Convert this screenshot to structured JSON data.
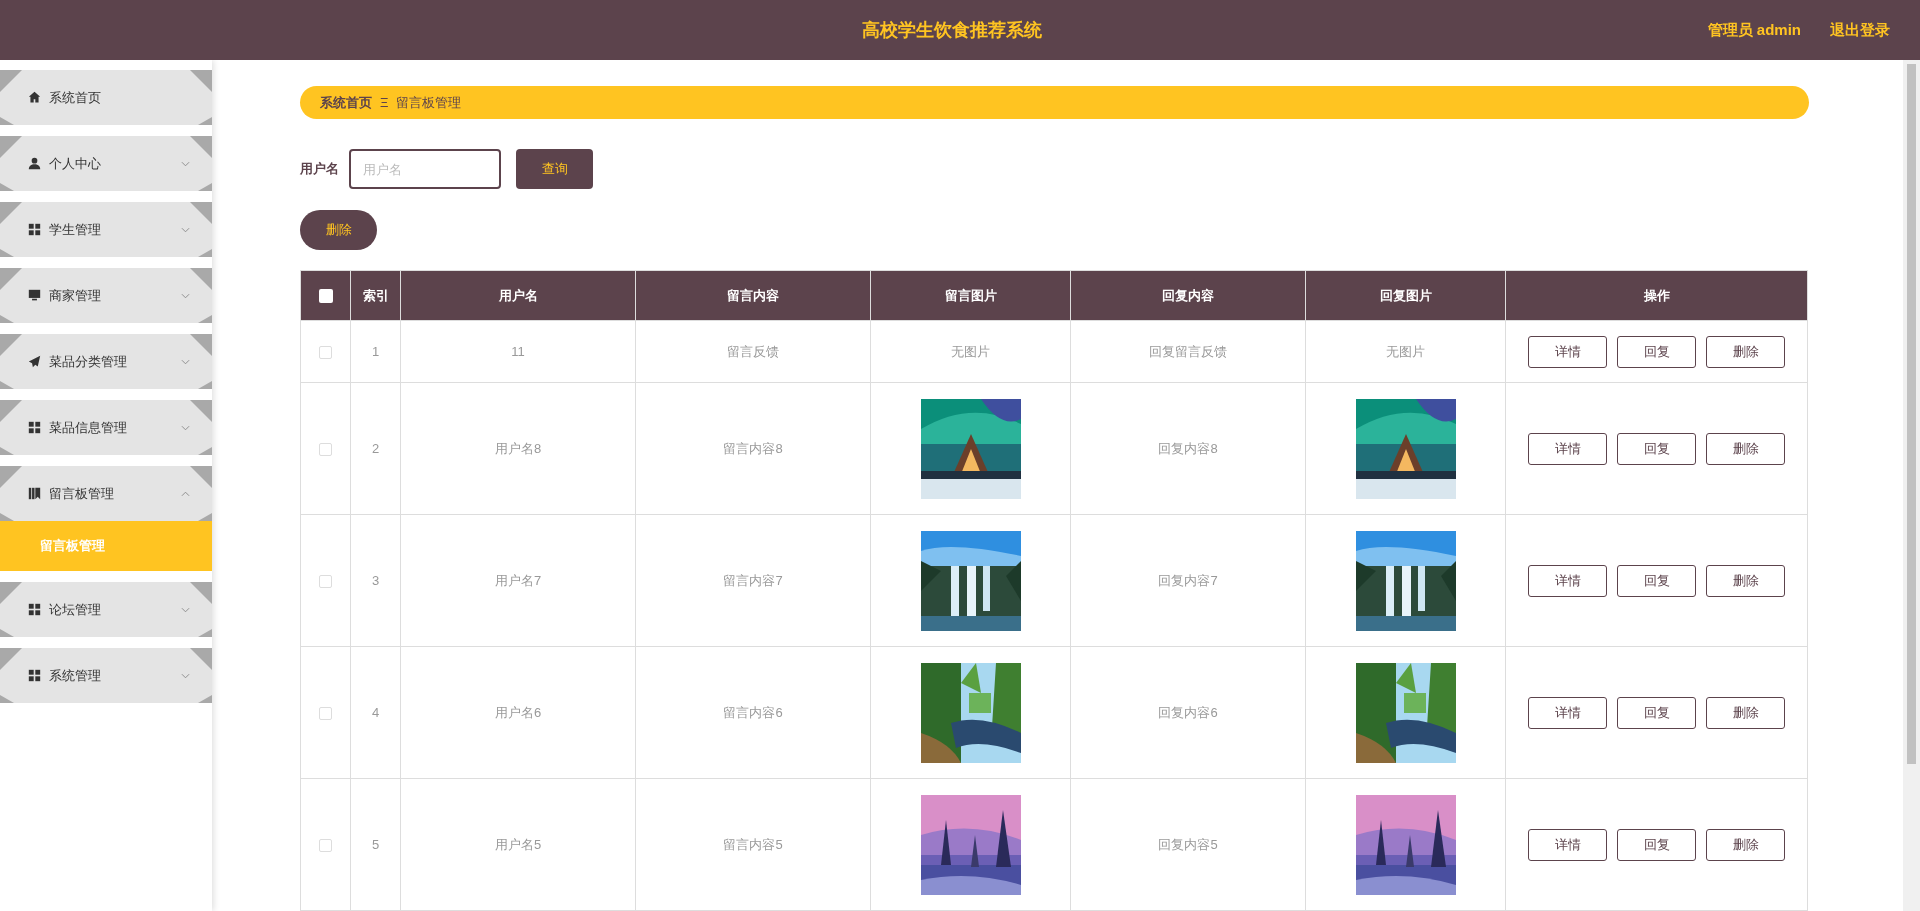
{
  "header": {
    "title": "高校学生饮食推荐系统",
    "user": "管理员 admin",
    "logout": "退出登录"
  },
  "sidebar": {
    "items": [
      {
        "kind": "link",
        "label": "系统首页"
      },
      {
        "kind": "menu",
        "label": "个人中心",
        "expanded": false
      },
      {
        "kind": "menu",
        "label": "学生管理",
        "expanded": false
      },
      {
        "kind": "menu",
        "label": "商家管理",
        "expanded": false
      },
      {
        "kind": "menu",
        "label": "菜品分类管理",
        "expanded": false
      },
      {
        "kind": "menu",
        "label": "菜品信息管理",
        "expanded": false
      },
      {
        "kind": "menu",
        "label": "留言板管理",
        "expanded": true,
        "children": [
          {
            "label": "留言板管理",
            "selected": true
          }
        ]
      },
      {
        "kind": "menu",
        "label": "论坛管理",
        "expanded": false
      },
      {
        "kind": "menu",
        "label": "系统管理",
        "expanded": false
      }
    ]
  },
  "breadcrumb": {
    "items": [
      "系统首页",
      "留言板管理"
    ],
    "separator": "Ξ"
  },
  "search": {
    "label": "用户名",
    "placeholder": "用户名",
    "button": "查询"
  },
  "delete_button": "删除",
  "table": {
    "select_all": {
      "checked": false
    },
    "columns": [
      "索引",
      "用户名",
      "留言内容",
      "留言图片",
      "回复内容",
      "回复图片",
      "操作"
    ],
    "rows": [
      {
        "checked": false,
        "index": "1",
        "username": "11",
        "content": "留言反馈",
        "image": {
          "kind": "text",
          "text": "无图片"
        },
        "reply": "回复留言反馈",
        "reply_image": {
          "kind": "text",
          "text": "无图片"
        },
        "actions": [
          "详情",
          "回复",
          "删除"
        ]
      },
      {
        "checked": false,
        "index": "2",
        "username": "用户名8",
        "content": "留言内容8",
        "image": {
          "kind": "picture"
        },
        "reply": "回复内容8",
        "reply_image": {
          "kind": "picture"
        },
        "actions": [
          "详情",
          "回复",
          "删除"
        ]
      },
      {
        "checked": false,
        "index": "3",
        "username": "用户名7",
        "content": "留言内容7",
        "image": {
          "kind": "picture"
        },
        "reply": "回复内容7",
        "reply_image": {
          "kind": "picture"
        },
        "actions": [
          "详情",
          "回复",
          "删除"
        ]
      },
      {
        "checked": false,
        "index": "4",
        "username": "用户名6",
        "content": "留言内容6",
        "image": {
          "kind": "picture"
        },
        "reply": "回复内容6",
        "reply_image": {
          "kind": "picture"
        },
        "actions": [
          "详情",
          "回复",
          "删除"
        ]
      },
      {
        "checked": false,
        "index": "5",
        "username": "用户名5",
        "content": "留言内容5",
        "image": {
          "kind": "picture"
        },
        "reply": "回复内容5",
        "reply_image": {
          "kind": "picture"
        },
        "actions": [
          "详情",
          "回复",
          "删除"
        ]
      }
    ]
  }
}
